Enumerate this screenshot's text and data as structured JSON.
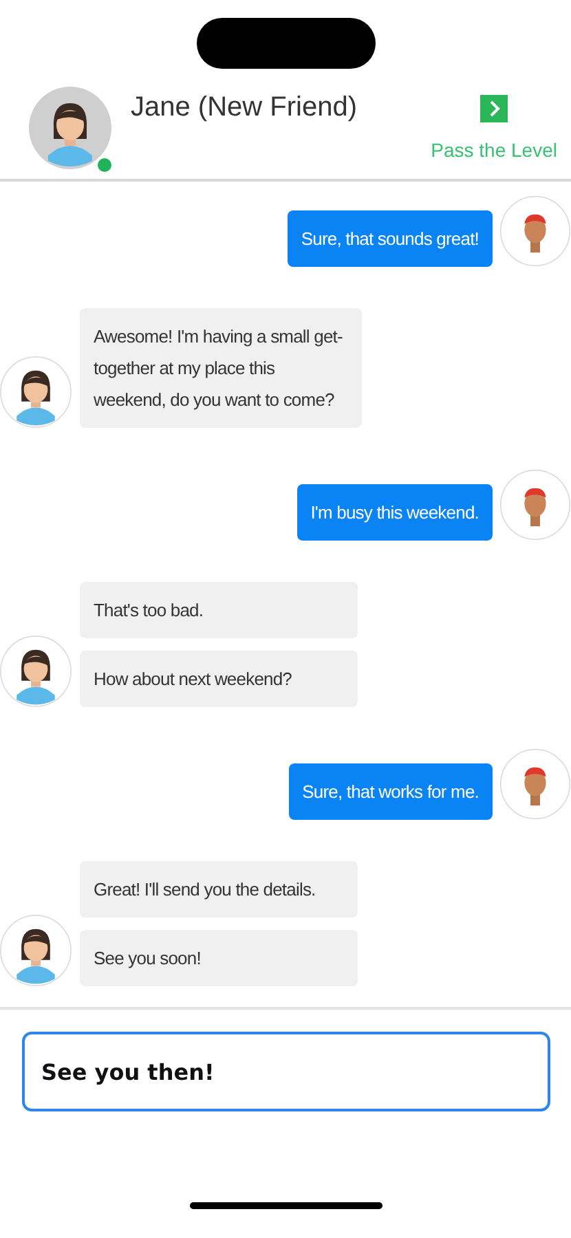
{
  "header": {
    "name": "Jane (New Friend)",
    "online": true,
    "action": {
      "label": "Pass the Level"
    }
  },
  "conversation": [
    {
      "kind": "sent",
      "messages": [
        "Sure, that sounds great!"
      ]
    },
    {
      "kind": "received",
      "messages": [
        "Awesome! I'm having a small get-together at my place this weekend, do you want to come?"
      ]
    },
    {
      "kind": "sent",
      "messages": [
        "I'm busy this weekend."
      ]
    },
    {
      "kind": "received",
      "messages": [
        "That's too bad.",
        "How about next weekend?"
      ]
    },
    {
      "kind": "sent",
      "messages": [
        "Sure, that works for me."
      ]
    },
    {
      "kind": "received",
      "messages": [
        "Great! I'll send you the details.",
        "See you soon!"
      ]
    }
  ],
  "composer": {
    "value": "See you then!"
  }
}
